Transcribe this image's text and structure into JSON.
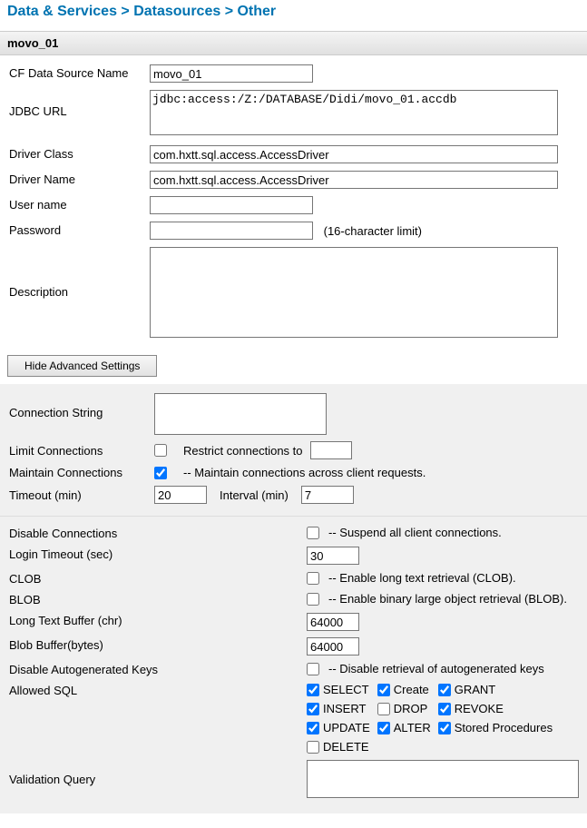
{
  "breadcrumb": "Data & Services > Datasources > Other",
  "header": "movo_01",
  "fields": {
    "dsname_label": "CF Data Source Name",
    "dsname_value": "movo_01",
    "jdbc_label": "JDBC URL",
    "jdbc_value": "jdbc:access:/Z:/DATABASE/Didi/movo_01.accdb",
    "driverclass_label": "Driver Class",
    "driverclass_value": "com.hxtt.sql.access.AccessDriver",
    "drivername_label": "Driver Name",
    "drivername_value": "com.hxtt.sql.access.AccessDriver",
    "username_label": "User name",
    "username_value": "",
    "password_label": "Password",
    "password_value": "",
    "password_hint": "(16-character limit)",
    "description_label": "Description",
    "description_value": ""
  },
  "buttons": {
    "hide_advanced": "Hide Advanced Settings"
  },
  "adv": {
    "connstring_label": "Connection String",
    "connstring_value": "",
    "limitconn_label": "Limit Connections",
    "limitconn_hint": "Restrict connections to",
    "limitconn_value": "",
    "maintain_label": "Maintain Connections",
    "maintain_hint": "-- Maintain connections across client requests.",
    "timeout_label": "Timeout (min)",
    "timeout_value": "20",
    "interval_label": "Interval (min)",
    "interval_value": "7"
  },
  "adv2": {
    "disableconn_label": "Disable Connections",
    "disableconn_hint": "-- Suspend all client connections.",
    "logintimeout_label": "Login Timeout (sec)",
    "logintimeout_value": "30",
    "clob_label": "CLOB",
    "clob_hint": "-- Enable long text retrieval (CLOB).",
    "blob_label": "BLOB",
    "blob_hint": "-- Enable binary large object retrieval (BLOB).",
    "longtext_label": "Long Text Buffer (chr)",
    "longtext_value": "64000",
    "blobbuf_label": "Blob Buffer(bytes)",
    "blobbuf_value": "64000",
    "disablekeys_label": "Disable Autogenerated Keys",
    "disablekeys_hint": "-- Disable retrieval of autogenerated keys",
    "allowedsql_label": "Allowed SQL",
    "validation_label": "Validation Query",
    "validation_value": ""
  },
  "sql": {
    "select": "SELECT",
    "create": "Create",
    "grant": "GRANT",
    "insert": "INSERT",
    "drop": "DROP",
    "revoke": "REVOKE",
    "update": "UPDATE",
    "alter": "ALTER",
    "sp": "Stored Procedures",
    "delete": "DELETE"
  },
  "indent": "    "
}
